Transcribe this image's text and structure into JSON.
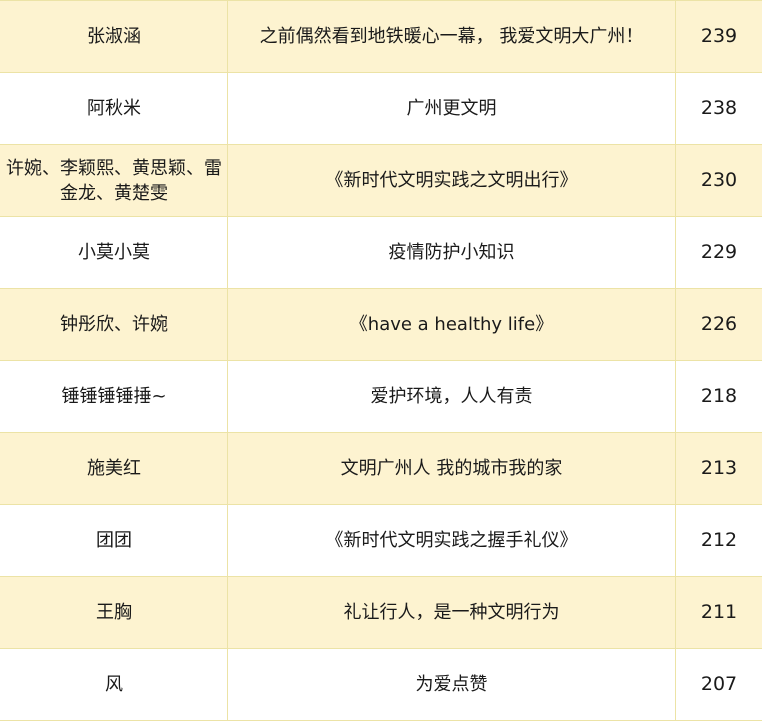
{
  "rows": [
    {
      "author": "张淑涵",
      "title": "之前偶然看到地铁暖心一幕， 我爱文明大广州！",
      "votes": "239"
    },
    {
      "author": "阿秋米",
      "title": "广州更文明",
      "votes": "238"
    },
    {
      "author": "许婉、李颖熙、黄思颖、雷金龙、黄楚雯",
      "title": "《新时代文明实践之文明出行》",
      "votes": "230"
    },
    {
      "author": "小莫小莫",
      "title": "疫情防护小知识",
      "votes": "229"
    },
    {
      "author": "钟彤欣、许婉",
      "title": "《have a healthy life》",
      "votes": "226"
    },
    {
      "author": "锤锤锤锤捶~",
      "title": "爱护环境，人人有责",
      "votes": "218"
    },
    {
      "author": "施美红",
      "title": "文明广州人 我的城市我的家",
      "votes": "213"
    },
    {
      "author": "团团",
      "title": "《新时代文明实践之握手礼仪》",
      "votes": "212"
    },
    {
      "author": "王胸",
      "title": "礼让行人，是一种文明行为",
      "votes": "211"
    },
    {
      "author": "风",
      "title": "为爱点赞",
      "votes": "207"
    }
  ]
}
